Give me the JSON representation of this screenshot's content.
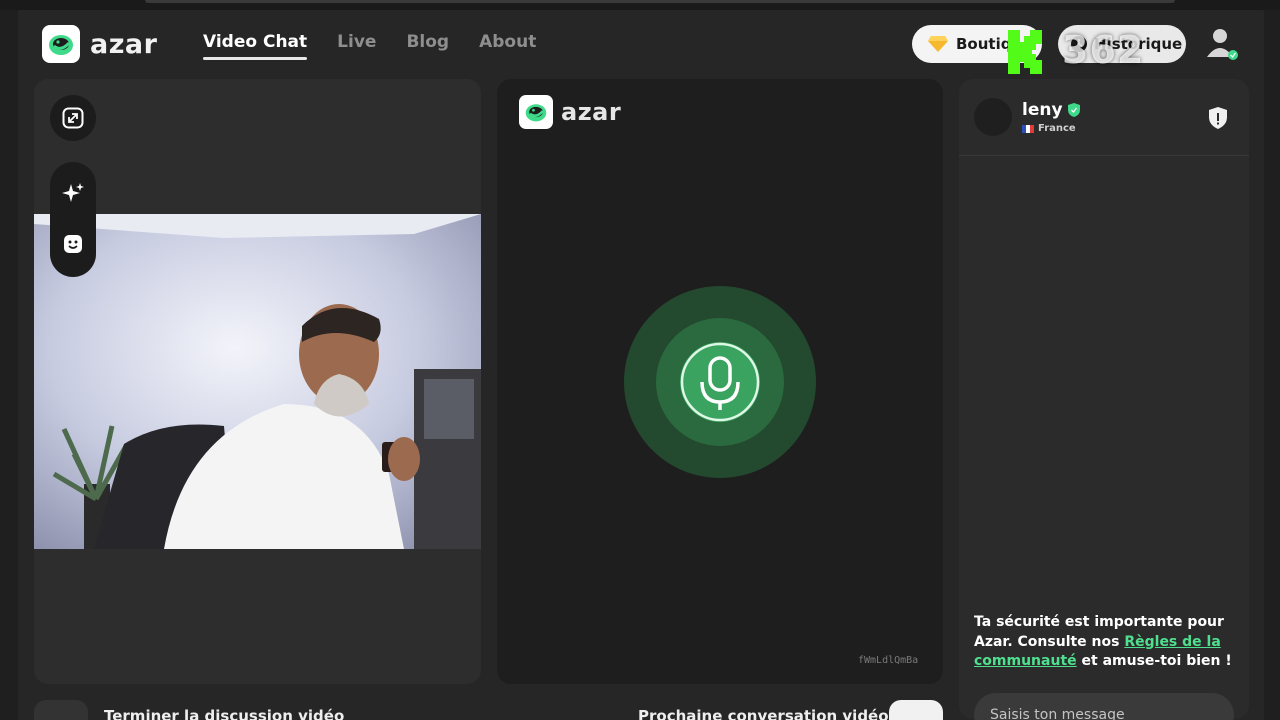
{
  "brand": {
    "name": "azar"
  },
  "nav": {
    "items": [
      {
        "label": "Video Chat",
        "active": true
      },
      {
        "label": "Live",
        "active": false
      },
      {
        "label": "Blog",
        "active": false
      },
      {
        "label": "About",
        "active": false
      }
    ]
  },
  "header": {
    "shop_label": "Boutiq",
    "history_label": "Historique",
    "viewer_count": "362"
  },
  "left_tools": {
    "icons": [
      "expand-icon",
      "sparkle-effects-icon",
      "face-filter-icon"
    ]
  },
  "middle": {
    "brand": "azar",
    "status_icon": "microphone-icon",
    "session_id": "fWmLdlQmBa"
  },
  "peer": {
    "name": "leny",
    "country": "France",
    "verified": true
  },
  "safety": {
    "text_before": "Ta sécurité est importante pour Azar. Consulte nos ",
    "link_label": "Règles de la communauté",
    "text_after": " et amuse-toi bien !"
  },
  "chat": {
    "placeholder": "Saisis ton message"
  },
  "bottom": {
    "end_label": "Terminer la discussion vidéo",
    "next_label": "Prochaine conversation vidéo"
  },
  "colors": {
    "accent": "#4fe08f",
    "mic_ring_outer": "#23492f",
    "mic_ring_mid": "#2a6a3e",
    "mic_core": "#3aa35f",
    "kick_green": "#53fc18"
  }
}
